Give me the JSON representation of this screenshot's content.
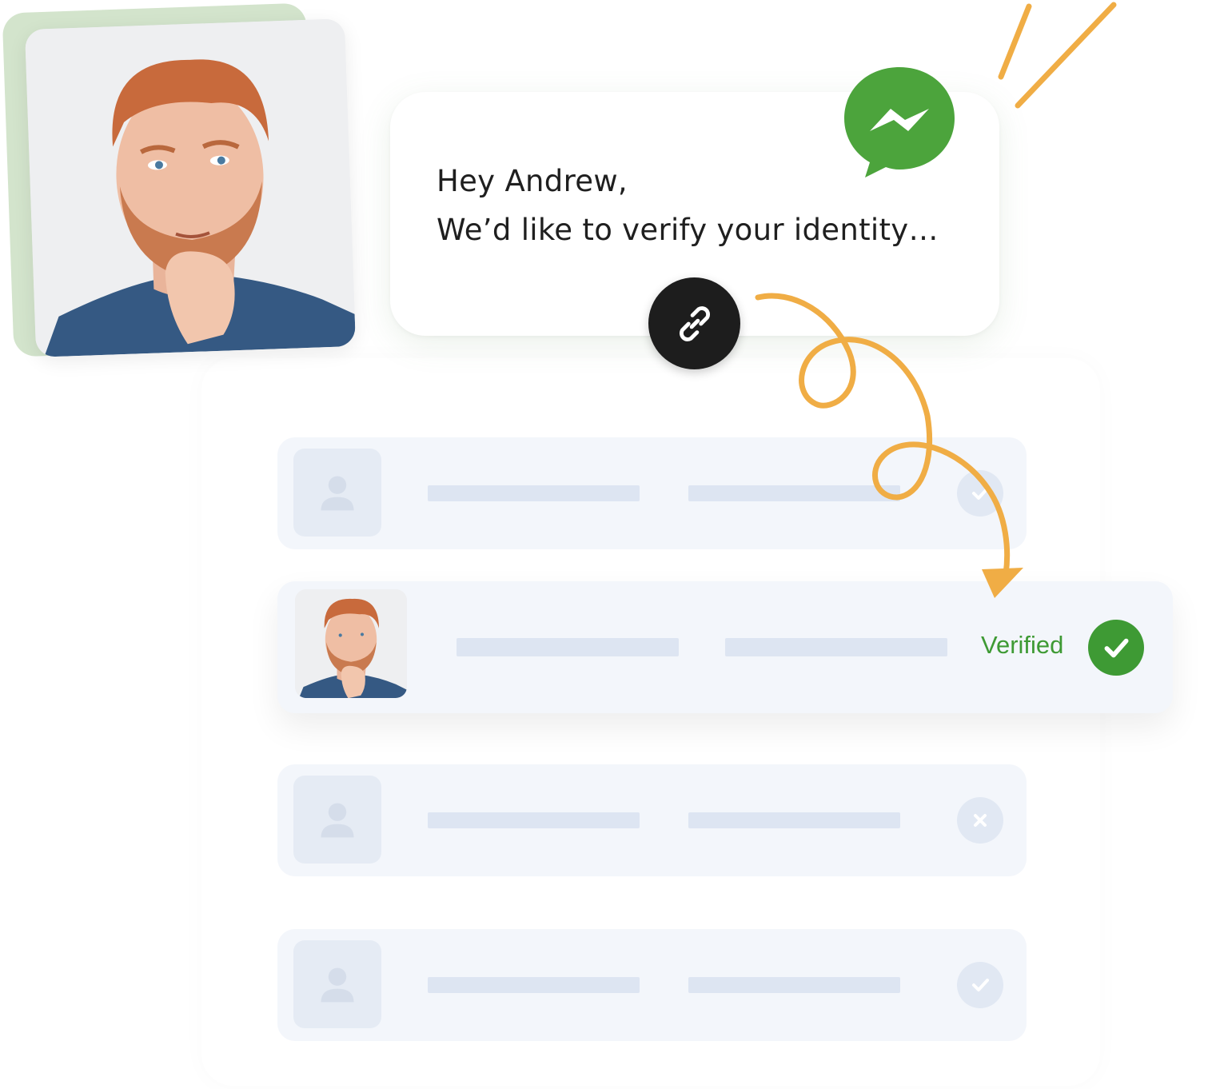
{
  "message": {
    "line1": "Hey Andrew,",
    "line2": "We’d like to verify your identity…",
    "channel_icon": "messenger-icon",
    "link_icon": "link-icon"
  },
  "profile": {
    "photo": "user-photo"
  },
  "list": {
    "rows": [
      {
        "status": "pending",
        "status_icon": "check-icon"
      },
      {
        "status": "verified",
        "status_label": "Verified",
        "status_icon": "check-icon"
      },
      {
        "status": "rejected",
        "status_icon": "close-icon"
      },
      {
        "status": "pending",
        "status_icon": "check-icon"
      }
    ]
  },
  "colors": {
    "accent_green": "#3e9a34",
    "messenger_green": "#4ca43c",
    "arrow_orange": "#f0ad45",
    "row_bg": "#f3f6fb",
    "placeholder_bar": "#dde5f2"
  }
}
